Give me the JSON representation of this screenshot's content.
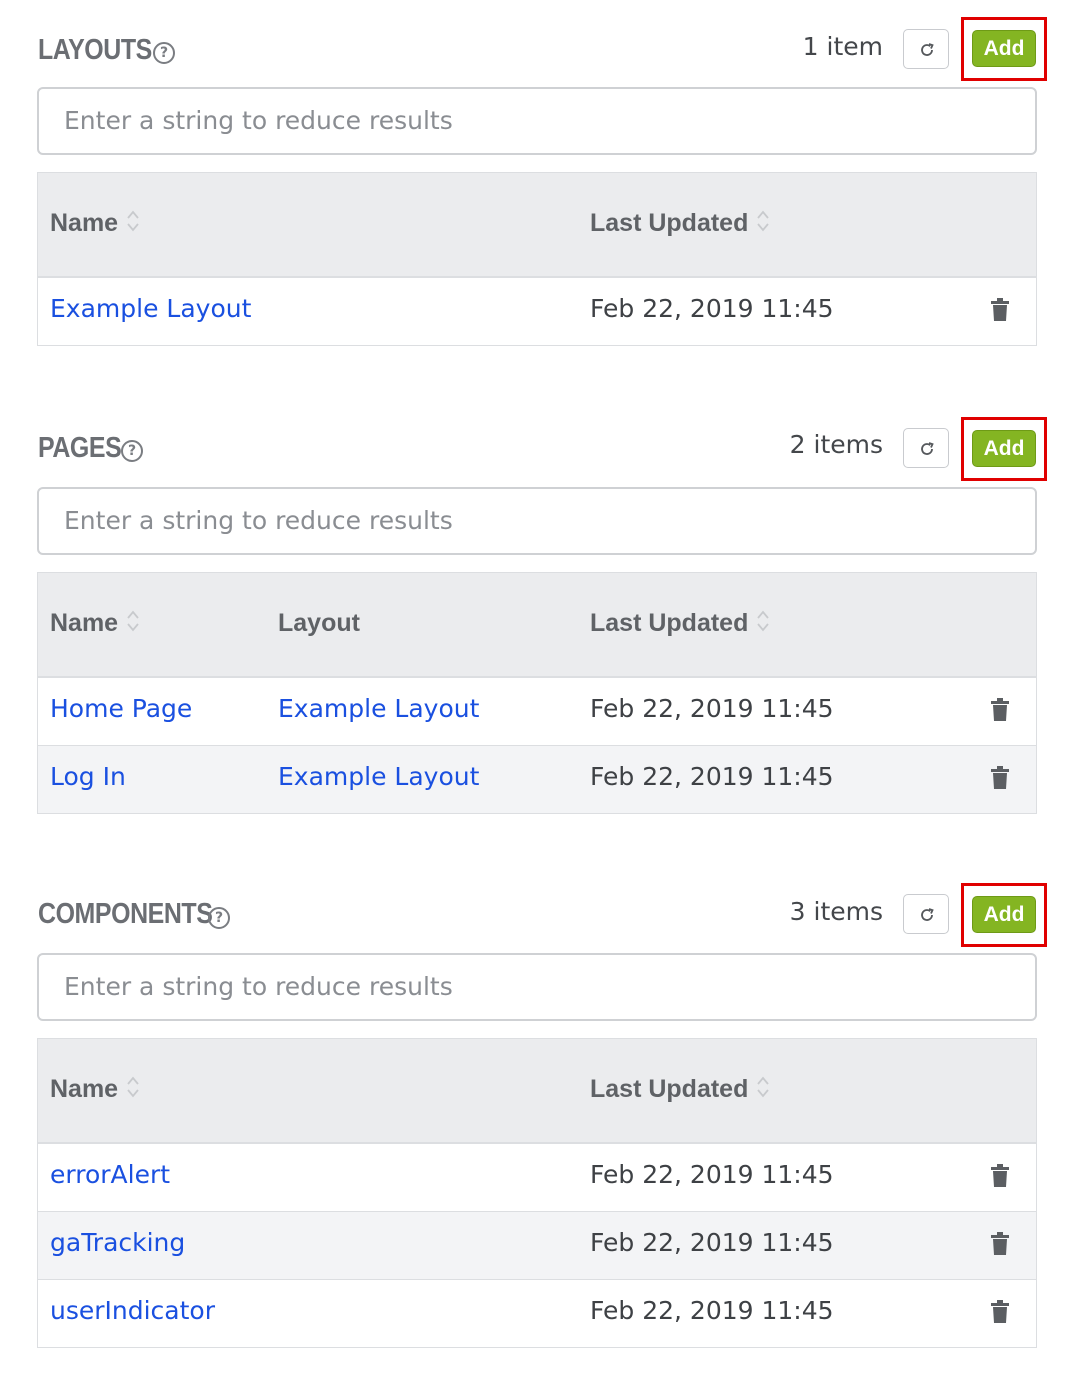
{
  "sections": [
    {
      "title": "LAYOUTS",
      "count": "1 item",
      "add_label": "Add",
      "filter_placeholder": "Enter a string to reduce results",
      "columns": {
        "name": "Name",
        "layout": "",
        "last_updated": "Last Updated"
      },
      "rows": [
        {
          "name": "Example Layout",
          "updated": "Feb 22, 2019 11:45"
        }
      ]
    },
    {
      "title": "PAGES",
      "count": "2 items",
      "add_label": "Add",
      "filter_placeholder": "Enter a string to reduce results",
      "columns": {
        "name": "Name",
        "layout": "Layout",
        "last_updated": "Last Updated"
      },
      "rows": [
        {
          "name": "Home Page",
          "layout": "Example Layout",
          "updated": "Feb 22, 2019 11:45"
        },
        {
          "name": "Log In",
          "layout": "Example Layout",
          "updated": "Feb 22, 2019 11:45"
        }
      ]
    },
    {
      "title": "COMPONENTS",
      "count": "3 items",
      "add_label": "Add",
      "filter_placeholder": "Enter a string to reduce results",
      "columns": {
        "name": "Name",
        "layout": "",
        "last_updated": "Last Updated"
      },
      "rows": [
        {
          "name": "errorAlert",
          "updated": "Feb 22, 2019 11:45"
        },
        {
          "name": "gaTracking",
          "updated": "Feb 22, 2019 11:45"
        },
        {
          "name": "userIndicator",
          "updated": "Feb 22, 2019 11:45"
        }
      ]
    }
  ],
  "icons": {
    "help": "help-circle-icon",
    "refresh": "refresh-icon",
    "sort": "sort-icon",
    "delete": "trash-icon"
  },
  "colors": {
    "add_button": "#84b522",
    "highlight_outline": "#e00000",
    "link": "#1a50e0"
  }
}
